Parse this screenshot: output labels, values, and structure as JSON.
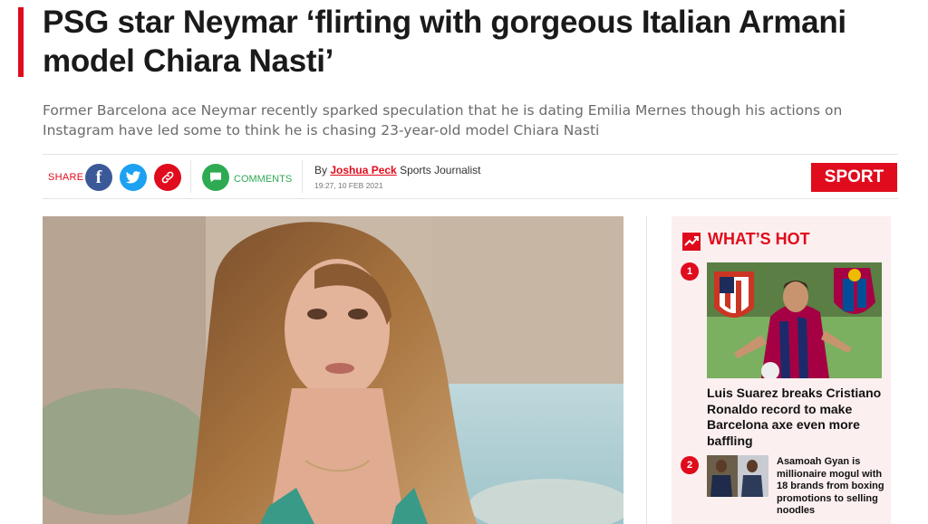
{
  "article": {
    "headline": "PSG star Neymar ‘flirting with gorgeous Italian Armani model Chiara Nasti’",
    "standfirst": "Former Barcelona ace Neymar recently sparked speculation that he is dating Emilia Mernes though his actions on Instagram have led some to think he is chasing 23-year-old model Chiara Nasti"
  },
  "meta": {
    "share_label": "SHARE",
    "facebook_glyph": "f",
    "twitter_glyph": "🐦",
    "link_glyph": "🔗",
    "comments_label": "COMMENTS",
    "by_prefix": "By",
    "author": "Joshua Peck",
    "author_role": "Sports Journalist",
    "timestamp": "19:27, 10 FEB 2021",
    "section_badge": "SPORT"
  },
  "sidebar": {
    "title": "WHAT’S HOT",
    "items": [
      {
        "rank": "1",
        "headline": "Luis Suarez breaks Cristiano Ronaldo record to make Barcelona axe even more baffling"
      },
      {
        "rank": "2",
        "headline": "Asamoah Gyan is millionaire mogul with 18 brands from boxing promotions to selling noodles"
      }
    ]
  },
  "colors": {
    "accent": "#e00b1c",
    "facebook": "#3b5998",
    "twitter": "#1da1f2",
    "comments": "#2eaa52",
    "sidebar_bg": "#fbeff0"
  }
}
